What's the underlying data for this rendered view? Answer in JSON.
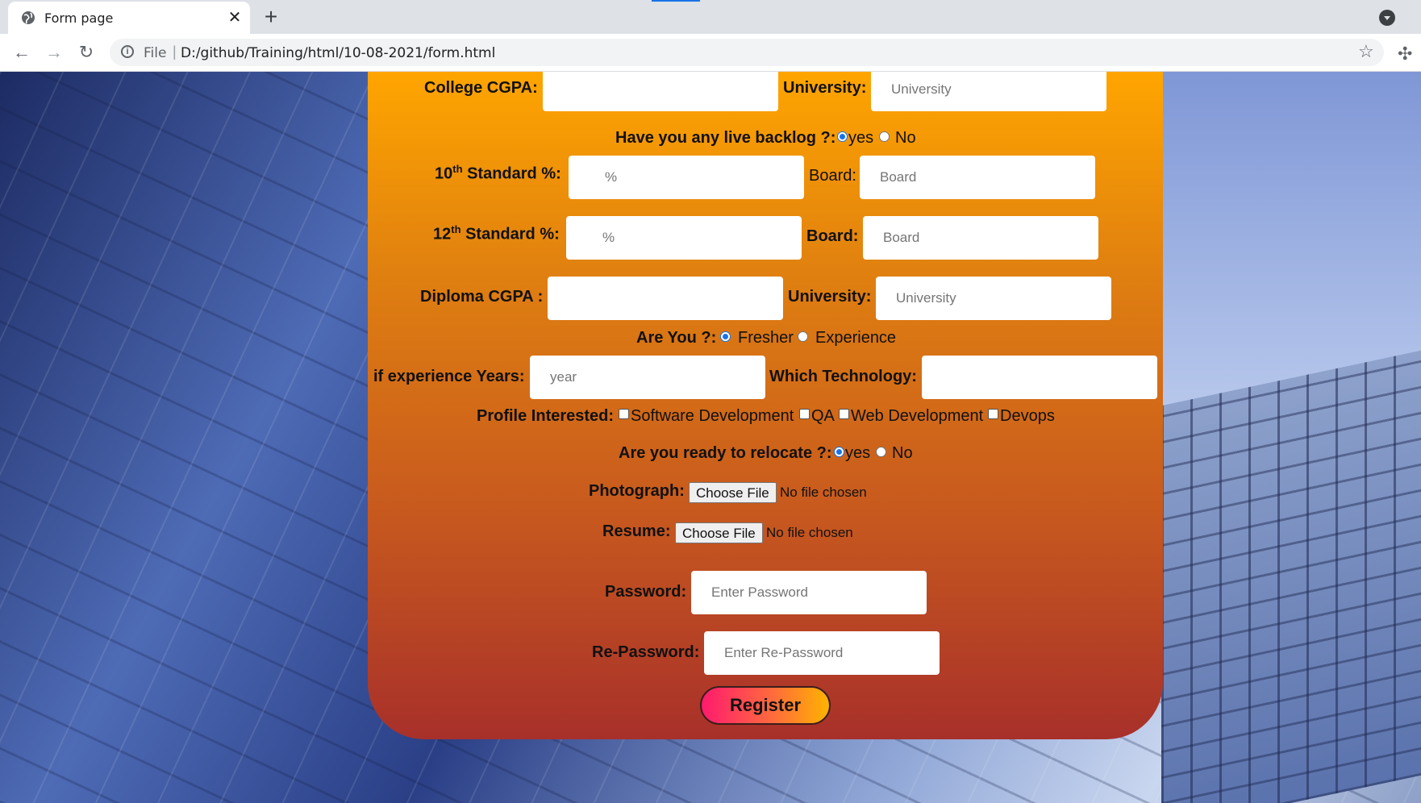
{
  "browser": {
    "tab_title": "Form page",
    "tab_close": "✕",
    "new_tab": "+",
    "url_scheme": "File",
    "url_sep": "|",
    "url": "D:/github/Training/html/10-08-2021/form.html"
  },
  "form": {
    "college_cgpa": {
      "label": "College CGPA:",
      "value": ""
    },
    "university1": {
      "label": "University:",
      "placeholder": "University"
    },
    "backlog": {
      "label": "Have you any live backlog ?:",
      "options": [
        "yes",
        "No"
      ],
      "selected": "yes"
    },
    "tenth": {
      "label_num": "10",
      "label_sup": "th",
      "label_rest": " Standard %:",
      "placeholder": "%",
      "board_label": "Board:",
      "board_placeholder": "Board"
    },
    "twelfth": {
      "label_num": "12",
      "label_sup": "th",
      "label_rest": " Standard %:",
      "placeholder": "%",
      "board_label": "Board:",
      "board_placeholder": "Board"
    },
    "diploma_cgpa": {
      "label": "Diploma CGPA :",
      "value": ""
    },
    "university2": {
      "label": "University:",
      "placeholder": "University"
    },
    "are_you": {
      "label": "Are You ?:",
      "options": [
        "Fresher",
        "Experience"
      ],
      "selected": "Fresher"
    },
    "experience_years": {
      "label": "if experience Years:",
      "placeholder": "year"
    },
    "technology": {
      "label": "Which Technology:",
      "value": ""
    },
    "profile": {
      "label": "Profile Interested:",
      "options": [
        "Software Development",
        "QA",
        "Web Development",
        "Devops"
      ]
    },
    "relocate": {
      "label": "Are you ready to relocate ?:",
      "options": [
        "yes",
        "No"
      ],
      "selected": "yes"
    },
    "photograph": {
      "label": "Photograph:",
      "button": "Choose File",
      "status": "No file chosen"
    },
    "resume": {
      "label": "Resume:",
      "button": "Choose File",
      "status": "No file chosen"
    },
    "password": {
      "label": "Password:",
      "placeholder": "Enter Password"
    },
    "repassword": {
      "label": "Re-Password:",
      "placeholder": "Enter Re-Password"
    },
    "register_label": "Register"
  },
  "colors": {
    "accent": "#1a73e8",
    "card_top": "#ffa500",
    "card_bottom": "#a8302a"
  }
}
